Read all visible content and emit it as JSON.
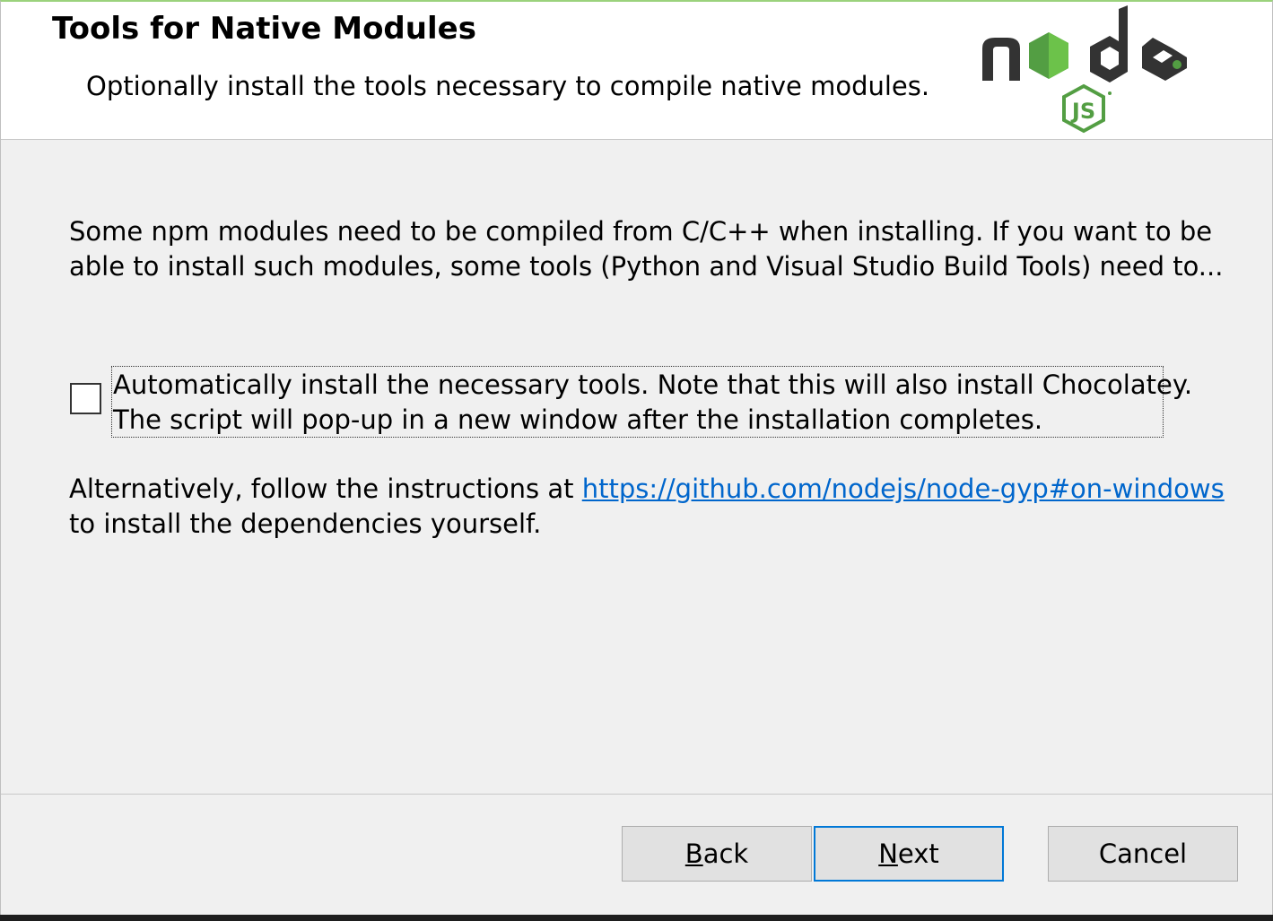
{
  "header": {
    "title": "Tools for Native Modules",
    "subtitle": "Optionally install the tools necessary to compile native modules."
  },
  "logo": {
    "wordmark": "node",
    "badge": "JS",
    "brand_dark": "#333333",
    "brand_green": "#539e43"
  },
  "intro": {
    "line1": "Some npm modules need to be compiled from C/C++ when installing. If you want to be",
    "line2": "able to install such modules, some tools (Python and Visual Studio Build Tools) need to..."
  },
  "auto_install": {
    "checked": false,
    "line1": "Automatically install the necessary tools. Note that this will also install Chocolatey.",
    "line2": "The script will pop-up in a new window after the installation completes."
  },
  "alternative": {
    "prefix": "Alternatively, follow the instructions at ",
    "link": "https://github.com/nodejs/node-gyp#on-windows",
    "line2": "to install the dependencies yourself."
  },
  "buttons": {
    "back_mnemonic": "B",
    "back_rest": "ack",
    "next_mnemonic": "N",
    "next_rest": "ext",
    "cancel": "Cancel"
  },
  "colors": {
    "link": "#0066cc",
    "focus_border": "#0078d7",
    "header_bg": "#ffffff",
    "dialog_bg": "#f0f0f0"
  }
}
